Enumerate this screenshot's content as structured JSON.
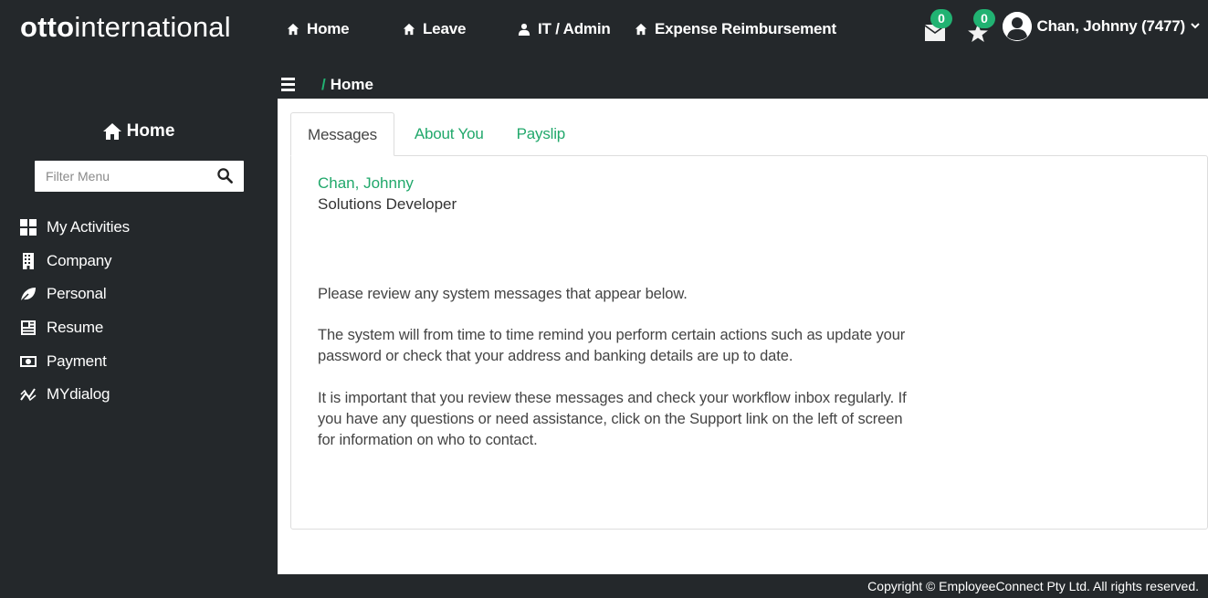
{
  "brand": {
    "bold": "otto",
    "light": "international"
  },
  "topnav": [
    {
      "label": "Home",
      "icon": "home-icon"
    },
    {
      "label": "Leave",
      "icon": "home-icon"
    },
    {
      "label": "IT / Admin",
      "icon": "user-icon"
    },
    {
      "label": "Expense Reimbursement",
      "icon": "home-icon"
    }
  ],
  "notifications": {
    "messages_count": "0",
    "favorites_count": "0"
  },
  "user": {
    "name": "Chan, Johnny (7477)"
  },
  "breadcrumb": {
    "separator": "/",
    "current": "Home"
  },
  "sidebar": {
    "title": "Home",
    "filter_placeholder": "Filter Menu",
    "items": [
      {
        "label": "My Activities",
        "icon": "grid-icon"
      },
      {
        "label": "Company",
        "icon": "building-icon"
      },
      {
        "label": "Personal",
        "icon": "leaf-icon"
      },
      {
        "label": "Resume",
        "icon": "newspaper-icon"
      },
      {
        "label": "Payment",
        "icon": "money-icon"
      },
      {
        "label": "MYdialog",
        "icon": "chart-line-icon"
      }
    ]
  },
  "tabs": [
    {
      "label": "Messages",
      "active": true
    },
    {
      "label": "About You",
      "active": false
    },
    {
      "label": "Payslip",
      "active": false
    }
  ],
  "employee": {
    "name": "Chan, Johnny",
    "role": "Solutions Developer"
  },
  "messages": {
    "p1": "Please review any system messages that appear below.",
    "p2": "The system will from time to time remind you perform certain actions such as update your password or check that your address and banking details are up to date.",
    "p3": "It is important that you review these messages and check your workflow inbox regularly. If you have any questions or need assistance, click on the Support link on the left of screen for information on who to contact."
  },
  "footer": {
    "copyright": "Copyright © EmployeeConnect Pty Ltd. All rights reserved."
  },
  "colors": {
    "accent": "#21b272",
    "background": "#24282b",
    "link": "#21a86b"
  }
}
